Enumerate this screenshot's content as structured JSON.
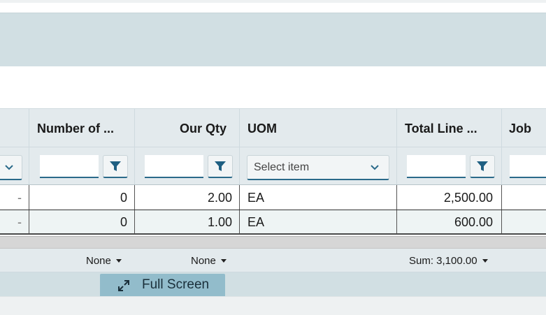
{
  "columns": [
    {
      "key": "col0",
      "label": ""
    },
    {
      "key": "number_of",
      "label": "Number of ..."
    },
    {
      "key": "our_qty",
      "label": "Our Qty"
    },
    {
      "key": "uom",
      "label": "UOM"
    },
    {
      "key": "total_line",
      "label": "Total Line ..."
    },
    {
      "key": "job",
      "label": "Job"
    }
  ],
  "filters": {
    "uom_placeholder": "Select item",
    "number_of_value": "",
    "our_qty_value": "",
    "total_line_value": "",
    "job_value": ""
  },
  "rows": [
    {
      "col0": "-",
      "number_of": "0",
      "our_qty": "2.00",
      "uom": "EA",
      "total_line": "2,500.00",
      "job": ""
    },
    {
      "col0": "-",
      "number_of": "0",
      "our_qty": "1.00",
      "uom": "EA",
      "total_line": "600.00",
      "job": ""
    }
  ],
  "aggregates": {
    "number_of": "None",
    "our_qty": "None",
    "total_line": "Sum: 3,100.00"
  },
  "fullscreen": {
    "label": "Full Screen",
    "icon": "expand-arrows-icon"
  },
  "colors": {
    "accent": "#2a6a8a",
    "header_bg": "#e3eaed",
    "band_bg": "#d1dfe3",
    "fullscreen_bg": "#92bccb"
  }
}
